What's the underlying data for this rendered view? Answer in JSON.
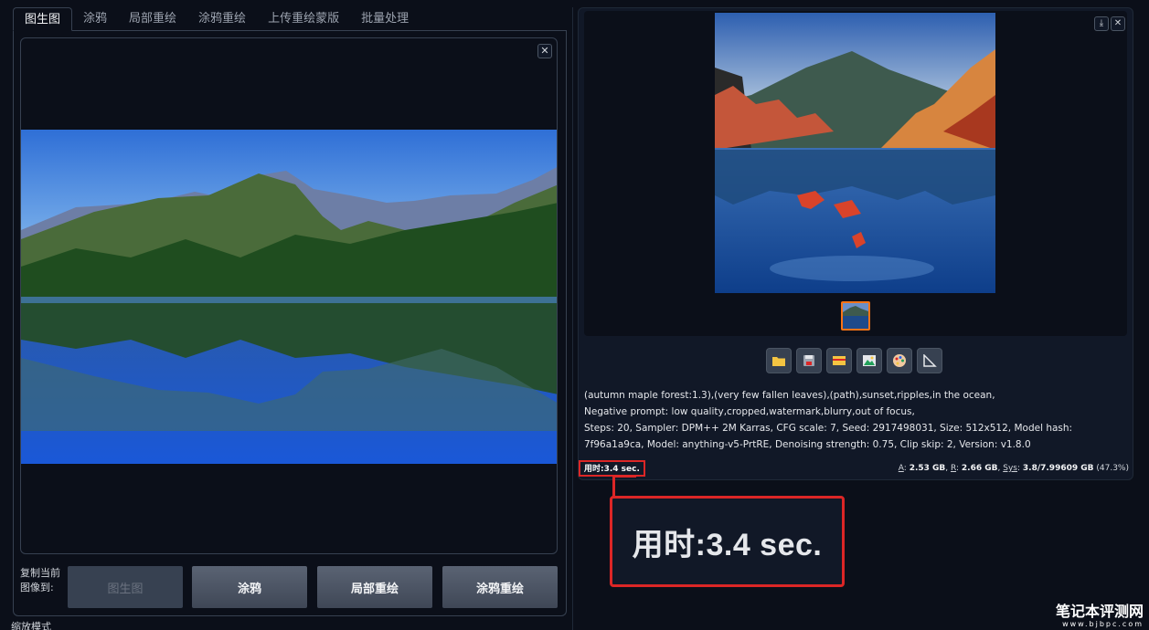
{
  "tabs": [
    {
      "label": "图生图",
      "active": true
    },
    {
      "label": "涂鸦",
      "active": false
    },
    {
      "label": "局部重绘",
      "active": false
    },
    {
      "label": "涂鸦重绘",
      "active": false
    },
    {
      "label": "上传重绘蒙版",
      "active": false
    },
    {
      "label": "批量处理",
      "active": false
    }
  ],
  "left": {
    "close_glyph": "✕",
    "copy_label": "复制当前图像到:",
    "copy_buttons": [
      "图生图",
      "涂鸦",
      "局部重绘",
      "涂鸦重绘"
    ],
    "zoom_mode_label": "缩放模式"
  },
  "right": {
    "download_glyph": "⤓",
    "close_glyph": "✕",
    "toolbar_icons": [
      "folder-icon",
      "save-icon",
      "zip-icon",
      "image-icon",
      "palette-icon",
      "ruler-icon"
    ],
    "prompt": "(autumn maple forest:1.3),(very few fallen leaves),(path),sunset,ripples,in the ocean,",
    "negative_prompt": "Negative prompt: low quality,cropped,watermark,blurry,out of focus,",
    "params": "Steps: 20, Sampler: DPM++ 2M Karras, CFG scale: 7, Seed: 2917498031, Size: 512x512, Model hash: 7f96a1a9ca, Model: anything-v5-PrtRE, Denoising strength: 0.75, Clip skip: 2, Version: v1.8.0",
    "time_label": "用时:",
    "time_value": "3.4 sec.",
    "mem_a_label": "A",
    "mem_a_value": "2.53 GB",
    "mem_r_label": "R",
    "mem_r_value": "2.66 GB",
    "mem_sys_label": "Sys",
    "mem_sys_value": "3.8/7.99609 GB",
    "mem_pct": "(47.3%)"
  },
  "callout": {
    "text": "用时:3.4 sec."
  },
  "watermark": {
    "line1": "笔记本评测网",
    "line2": "www.bjbpc.com"
  },
  "colors": {
    "background": "#0b0f19",
    "highlight": "#dc2626",
    "selected": "#f97316"
  }
}
